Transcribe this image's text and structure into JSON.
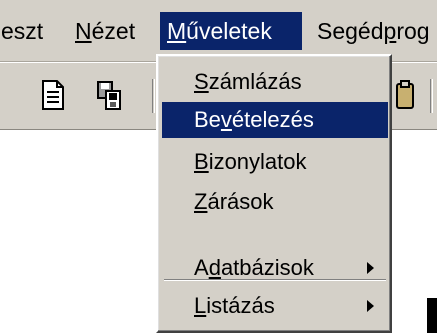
{
  "menubar": {
    "items": [
      {
        "pre": "",
        "acc": "",
        "post": "eszt"
      },
      {
        "pre": "",
        "acc": "N",
        "post": "ézet"
      },
      {
        "pre": "",
        "acc": "M",
        "post": "űveletek"
      },
      {
        "pre": "Segéd",
        "acc": "p",
        "post": "rog"
      }
    ]
  },
  "dropdown": {
    "items": [
      {
        "pre": "",
        "acc": "S",
        "post": "zámlázás"
      },
      {
        "pre": "Be",
        "acc": "v",
        "post": "ételezés"
      },
      {
        "pre": "",
        "acc": "B",
        "post": "izonylatok"
      },
      {
        "pre": "",
        "acc": "Z",
        "post": "árások"
      },
      {
        "pre": "A",
        "acc": "d",
        "post": "atbázisok"
      },
      {
        "pre": "",
        "acc": "L",
        "post": "istázás"
      }
    ]
  },
  "colors": {
    "face": "#d4d0c8",
    "highlight": "#0a246a"
  },
  "icons": [
    "document-icon",
    "save-copy-icon",
    "clipboard-icon"
  ]
}
